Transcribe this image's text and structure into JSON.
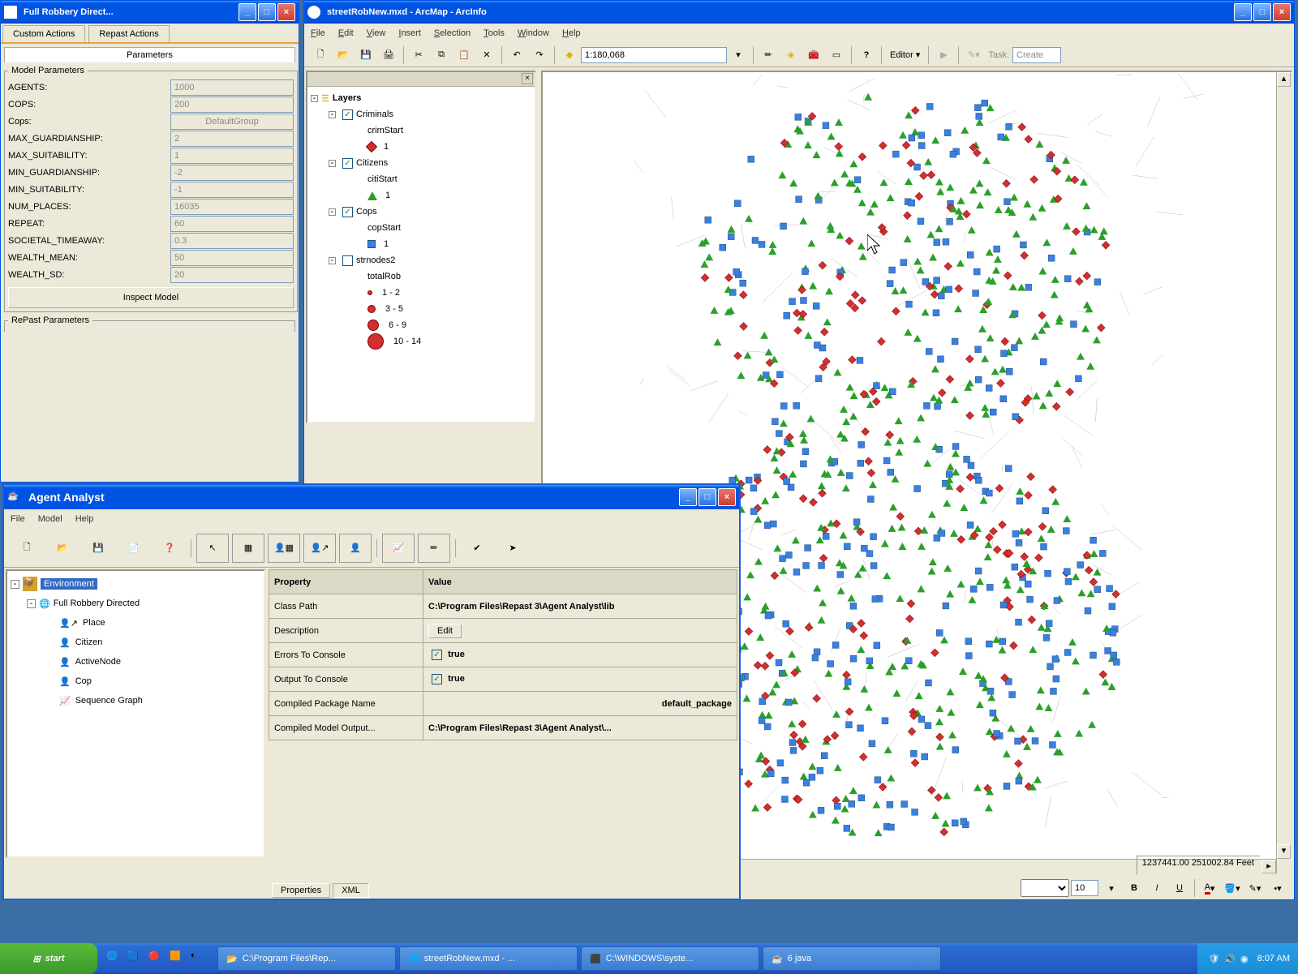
{
  "robbery": {
    "title": "Full Robbery Direct...",
    "tabs": {
      "custom": "Custom Actions",
      "repast": "Repast Actions",
      "parameters": "Parameters"
    },
    "fieldset": "Model Parameters",
    "repast_fieldset": "RePast Parameters",
    "inspect": "Inspect Model",
    "params": [
      {
        "label": "AGENTS:",
        "value": "1000"
      },
      {
        "label": "COPS:",
        "value": "200"
      },
      {
        "label": "Cops:",
        "value": "DefaultGroup",
        "center": true
      },
      {
        "label": "MAX_GUARDIANSHIP:",
        "value": "2"
      },
      {
        "label": "MAX_SUITABILITY:",
        "value": "1"
      },
      {
        "label": "MIN_GUARDIANSHIP:",
        "value": "-2"
      },
      {
        "label": "MIN_SUITABILITY:",
        "value": "-1"
      },
      {
        "label": "NUM_PLACES:",
        "value": "16035"
      },
      {
        "label": "REPEAT:",
        "value": "60"
      },
      {
        "label": "SOCIETAL_TIMEAWAY:",
        "value": "0.3"
      },
      {
        "label": "WEALTH_MEAN:",
        "value": "50"
      },
      {
        "label": "WEALTH_SD:",
        "value": "20"
      }
    ]
  },
  "arcmap": {
    "title": "streetRobNew.mxd - ArcMap - ArcInfo",
    "menus": [
      "File",
      "Edit",
      "View",
      "Insert",
      "Selection",
      "Tools",
      "Window",
      "Help"
    ],
    "scale": "1:180,068",
    "editor": "Editor",
    "task": "Task:",
    "create": "Create",
    "toc": {
      "root": "Layers",
      "layers": [
        {
          "name": "Criminals",
          "checked": true,
          "sub": "crimStart",
          "symbol": "diamond",
          "symlabel": "1"
        },
        {
          "name": "Citizens",
          "checked": true,
          "sub": "citiStart",
          "symbol": "triangle",
          "symlabel": "1"
        },
        {
          "name": "Cops",
          "checked": true,
          "sub": "copStart",
          "symbol": "square",
          "symlabel": "1"
        },
        {
          "name": "strnodes2",
          "checked": false,
          "sub": "totalRob"
        }
      ],
      "totalRob": [
        {
          "size": 6,
          "label": "1 - 2"
        },
        {
          "size": 10,
          "label": "3 - 5"
        },
        {
          "size": 14,
          "label": "6 - 9"
        },
        {
          "size": 20,
          "label": "10 - 14"
        }
      ]
    },
    "fontsize": "10",
    "coords": "1237441.00 251002.84 Feet"
  },
  "agent": {
    "title": "Agent Analyst",
    "menus": [
      "File",
      "Model",
      "Help"
    ],
    "tree": {
      "root": "Environment",
      "model": "Full Robbery Directed",
      "nodes": [
        "Place",
        "Citizen",
        "ActiveNode",
        "Cop",
        "Sequence Graph"
      ]
    },
    "proptable": {
      "hdr": [
        "Property",
        "Value"
      ],
      "rows": [
        {
          "p": "Class Path",
          "v": "C:\\Program Files\\Repast 3\\Agent Analyst\\lib"
        },
        {
          "p": "Description",
          "v": "Edit",
          "btn": true
        },
        {
          "p": "Errors To Console",
          "v": "true",
          "chk": true
        },
        {
          "p": "Output To Console",
          "v": "true",
          "chk": true
        },
        {
          "p": "Compiled Package Name",
          "v": "default_package",
          "right": true
        },
        {
          "p": "Compiled Model Output...",
          "v": "C:\\Program Files\\Repast 3\\Agent Analyst\\..."
        }
      ]
    },
    "bottomtabs": [
      "Properties",
      "XML"
    ]
  },
  "taskbar": {
    "start": "start",
    "buttons": [
      "C:\\Program Files\\Rep...",
      "streetRobNew.mxd - ...",
      "C:\\WINDOWS\\syste...",
      "6 java"
    ],
    "time": "8:07 AM"
  }
}
